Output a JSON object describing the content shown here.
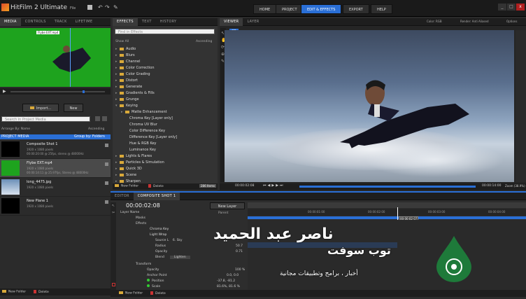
{
  "app": {
    "title": "HitFilm 2 Ultimate",
    "menu": [
      "File"
    ]
  },
  "nav": {
    "buttons": [
      "HOME",
      "PROJECT",
      "EDIT & EFFECTS",
      "EXPORT",
      "HELP"
    ],
    "active": "EDIT & EFFECTS"
  },
  "window_controls": [
    "_",
    "□",
    "x"
  ],
  "left_tabs": [
    "MEDIA",
    "CONTROLS",
    "TRACK",
    "LIFETIME"
  ],
  "preview": {
    "clip_label": "Flybe EXT.mp4"
  },
  "import": {
    "import_label": "Import...",
    "new_label": "New"
  },
  "media_search": {
    "placeholder": "Search in Project Media"
  },
  "arrange": {
    "arrange_label": "Arrange By: Name",
    "order_label": "Ascending"
  },
  "project_media": {
    "title": "PROJECT MEDIA",
    "group": "Group by: Folders"
  },
  "media_items": [
    {
      "name": "Composite Shot 1",
      "info1": "1920 x 1080 pixels",
      "info2": "00:00:20:00 @ 25fps, stereo @ 48000Hz"
    },
    {
      "name": "Flybe EXT.mp4",
      "info1": "1920 x 1080 pixels",
      "info2": "00:00:14:11 @ 25.97fps, Stereo @ 48000Hz"
    },
    {
      "name": "long_4475.jpg",
      "info1": "1920 x 1080 pixels",
      "info2": ""
    },
    {
      "name": "New Plane 1",
      "info1": "1920 x 1080 pixels",
      "info2": ""
    }
  ],
  "left_bottom": {
    "new_folder": "New Folder",
    "delete": "Delete"
  },
  "effects_tabs": [
    "EFFECTS",
    "TEXT",
    "HISTORY"
  ],
  "effects_search": {
    "placeholder": "Find in Effects"
  },
  "effects_filter": {
    "show": "Show All",
    "order": "Ascending"
  },
  "effects_folders": [
    "Audio",
    "Blurs",
    "Channel",
    "Color Correction",
    "Color Grading",
    "Distort",
    "Generate",
    "Gradients & Fills",
    "Grunge"
  ],
  "keying": {
    "name": "Keying",
    "matte": "Matte Enhancement",
    "children": [
      "Chroma Key [Layer only]",
      "Chroma UV Blur",
      "Color Difference Key",
      "Difference Key [Layer only]",
      "Hue & RGB Key",
      "Luminance Key"
    ]
  },
  "effects_folders_after": [
    "Lights & Flares",
    "Particles & Simulation",
    "Quick 3D",
    "Scene",
    "Sharpen"
  ],
  "effects_bottom": {
    "new_folder": "New Folder",
    "delete": "Delete",
    "count": "286 Items"
  },
  "viewer": {
    "tabs": [
      "VIEWER",
      "LAYER"
    ],
    "mode": "2D",
    "color": "Color: RGB",
    "render": "Render: Anti Aliased",
    "options": "Options",
    "timecode_left": "00:00:02:08",
    "timecode_right": "00:00:14:00",
    "zoom": "Zoom (38.9%)"
  },
  "timeline": {
    "tabs": [
      "EDITOR",
      "COMPOSITE SHOT 1"
    ],
    "timecode": "00:00:02:08",
    "new_layer": "New Layer",
    "parent": "Parent",
    "layer_name": "Layer Name",
    "properties": "Properties",
    "export": "Export",
    "marker": "00:00:02:07"
  },
  "timeline_ruler": [
    "00:00:01:00",
    "00:00:02:00",
    "00:00:03:00",
    "00:00:04:00"
  ],
  "layers": {
    "masks": "Masks",
    "effects": "Effects",
    "chroma": "Chroma Key",
    "lightwrap": "Light Wrap",
    "source": "Source L",
    "source_val": "6. Sky",
    "radius": "Radius",
    "radius_val": "50.7",
    "opacity": "Opacity",
    "opacity_val": "0.71",
    "blend": "Blend",
    "blend_val": "Lighten",
    "transform": "Transform",
    "t_opacity": "Opacity",
    "t_opacity_val": "100 %",
    "anchor": "Anchor Point",
    "anchor_val": "0.0,  0.0",
    "position": "Position",
    "position_val": "-37.8,  -81.2",
    "scale": "Scale",
    "scale_val": "81.6%, 81.6 %"
  },
  "timeline_bottom": {
    "new_folder": "New Folder",
    "delete": "Delete"
  },
  "watermark": {
    "name": "ناصر عبد الحميد",
    "brand": "توب سوفت",
    "tagline": "أخبار ، برامج وتطبيقات مجانية"
  },
  "colors": {
    "accent": "#2a6fd6",
    "green_screen": "#1ea31e",
    "folder": "#d9a93a"
  }
}
